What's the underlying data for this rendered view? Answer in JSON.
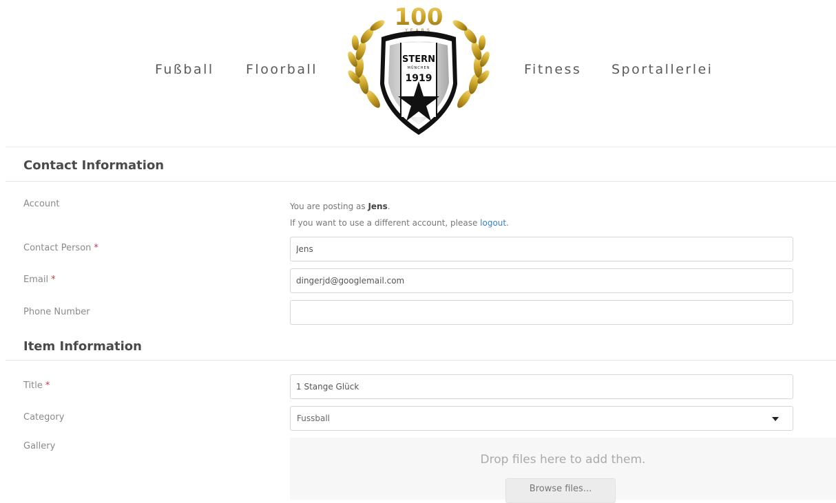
{
  "nav": {
    "items": [
      "Fußball",
      "Floorball",
      "Fitness",
      "Sportallerlei"
    ]
  },
  "logo": {
    "anniversary": "100",
    "years": "YEARS",
    "club_name": "STERN",
    "city": "MÜNCHEN",
    "year": "1919"
  },
  "contact_section": {
    "title": "Contact Information",
    "account_label": "Account",
    "posting_as_prefix": "You are posting as ",
    "username": "Jens",
    "posting_as_suffix": ".",
    "switch_prefix": "If you want to use a different account, please ",
    "logout_link": "logout",
    "switch_suffix": ".",
    "contact_person_label": "Contact Person",
    "contact_person_value": "Jens",
    "email_label": "Email",
    "email_value": "dingerjd@googlemail.com",
    "phone_label": "Phone Number",
    "phone_value": "",
    "required_mark": "*"
  },
  "item_section": {
    "title": "Item Information",
    "title_label": "Title",
    "title_value": "1 Stange Glück",
    "category_label": "Category",
    "category_value": "Fussball",
    "gallery_label": "Gallery",
    "dropzone_text": "Drop files here to add them.",
    "browse_label": "Browse files..."
  },
  "colors": {
    "required": "#d9304e",
    "link": "#3a7fc3",
    "laurel_gold": "#c9a227"
  }
}
